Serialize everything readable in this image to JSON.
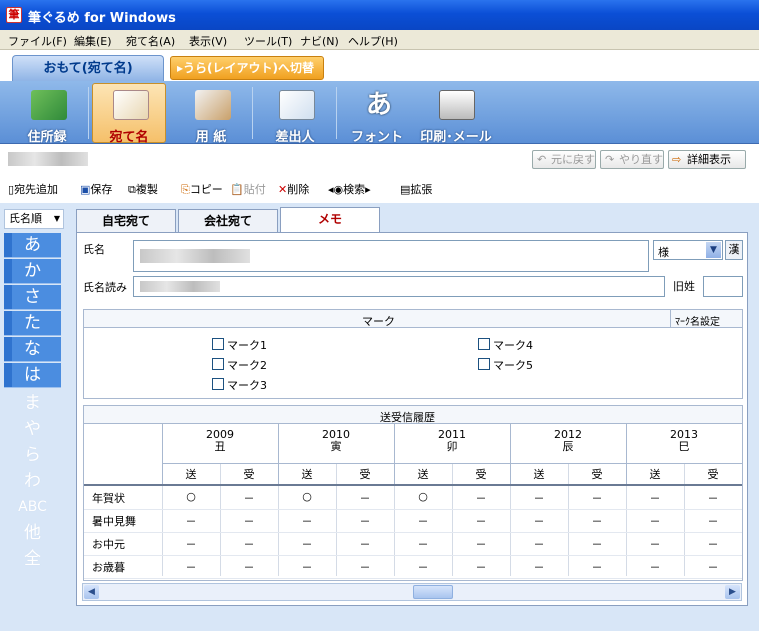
{
  "window": {
    "title": "筆ぐるめ for Windows",
    "icon": "fude-app-icon"
  },
  "menu": [
    "ファイル(F)",
    "編集(E)",
    "宛て名(A)",
    "表示(V)",
    "ツール(T)",
    "ナビ(N)",
    "ヘルプ(H)"
  ],
  "top_tabs": {
    "front": "おもて(宛て名)",
    "switch": "うら(レイアウト)へ切替"
  },
  "ribbon": [
    {
      "label": "住所録",
      "icon": "address-book-icon"
    },
    {
      "label": "宛て名",
      "icon": "postcard-pen-icon",
      "selected": true
    },
    {
      "label": "用 紙",
      "icon": "paper-envelope-icon"
    },
    {
      "label": "差出人",
      "icon": "sender-postcard-icon"
    },
    {
      "label": "フォント",
      "icon": "font-a-icon"
    },
    {
      "label": "印刷･メール",
      "icon": "printer-mail-icon"
    }
  ],
  "infobar": {
    "undo": "元に戻す",
    "redo": "やり直す",
    "detail": "詳細表示"
  },
  "toolbar": {
    "add": "宛先追加",
    "save": "保存",
    "dup": "複製",
    "copy": "コピー",
    "paste": "貼付",
    "delete": "削除",
    "search": "検索",
    "expand": "拡張"
  },
  "sort": {
    "label": "氏名順"
  },
  "kana_index": [
    {
      "char": "あ",
      "active": true
    },
    {
      "char": "か",
      "active": true
    },
    {
      "char": "さ",
      "active": true
    },
    {
      "char": "た",
      "active": true
    },
    {
      "char": "な",
      "active": true
    },
    {
      "char": "は",
      "active": true
    },
    {
      "char": "ま",
      "active": false
    },
    {
      "char": "や",
      "active": false
    },
    {
      "char": "ら",
      "active": false
    },
    {
      "char": "わ",
      "active": false
    },
    {
      "char": "ABC",
      "active": false
    },
    {
      "char": "他",
      "active": false
    },
    {
      "char": "全",
      "active": false
    }
  ],
  "content_tabs": [
    {
      "label": "自宅宛て"
    },
    {
      "label": "会社宛て"
    },
    {
      "label": "メモ",
      "selected": true
    }
  ],
  "form": {
    "name_label": "氏名",
    "reading_label": "氏名読み",
    "honorific": "様",
    "kanji_btn": "漢",
    "old_surname_label": "旧姓"
  },
  "marks": {
    "header": "マーク",
    "setting": "ﾏｰｸ名設定",
    "items": [
      {
        "label": "マーク1"
      },
      {
        "label": "マーク2"
      },
      {
        "label": "マーク3"
      },
      {
        "label": "マーク4"
      },
      {
        "label": "マーク5"
      }
    ]
  },
  "history": {
    "header": "送受信履歴",
    "years": [
      {
        "year": "2009",
        "eto": "丑"
      },
      {
        "year": "2010",
        "eto": "寅"
      },
      {
        "year": "2011",
        "eto": "卯"
      },
      {
        "year": "2012",
        "eto": "辰"
      },
      {
        "year": "2013",
        "eto": "巳"
      }
    ],
    "sent": "送",
    "received": "受",
    "rows": [
      {
        "label": "年賀状",
        "cells": [
          "○",
          "－",
          "○",
          "－",
          "○",
          "－",
          "－",
          "－",
          "－",
          "－"
        ]
      },
      {
        "label": "暑中見舞",
        "cells": [
          "－",
          "－",
          "－",
          "－",
          "－",
          "－",
          "－",
          "－",
          "－",
          "－"
        ]
      },
      {
        "label": "お中元",
        "cells": [
          "－",
          "－",
          "－",
          "－",
          "－",
          "－",
          "－",
          "－",
          "－",
          "－"
        ]
      },
      {
        "label": "お歳暮",
        "cells": [
          "－",
          "－",
          "－",
          "－",
          "－",
          "－",
          "－",
          "－",
          "－",
          "－"
        ]
      }
    ]
  },
  "colors": {
    "accent": "#0b4fd6",
    "selected": "#b00000",
    "panel_bg": "#d8e6f7"
  }
}
